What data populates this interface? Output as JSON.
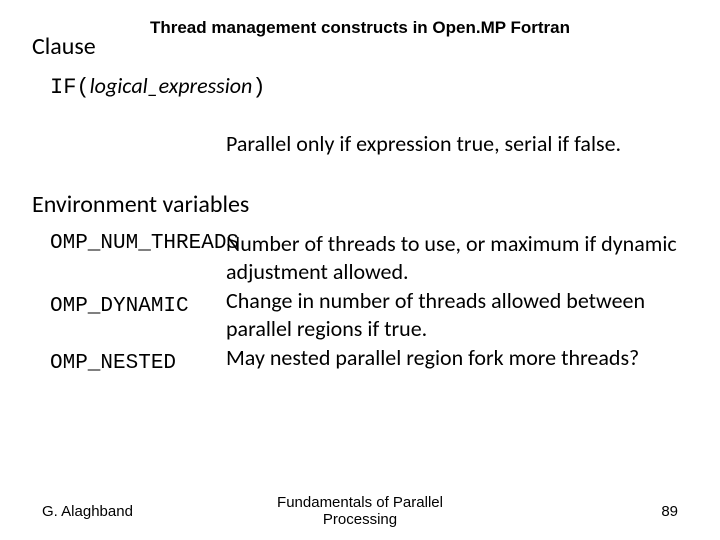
{
  "title": "Thread management constructs in Open.MP Fortran",
  "clause_label": "Clause",
  "if_keyword": "IF",
  "if_open": "(",
  "if_arg": "logical_expression",
  "if_close": ")",
  "clause_desc": "Parallel only if expression true, serial if false.",
  "env_label": "Environment variables",
  "rows": [
    {
      "name": "OMP_NUM_THREADS",
      "desc": "Number of threads to use, or maximum if dynamic adjustment allowed."
    },
    {
      "name": "OMP_DYNAMIC",
      "desc": "Change in number of threads allowed between parallel regions if true."
    },
    {
      "name": "OMP_NESTED",
      "desc": "May nested parallel region fork more threads?"
    }
  ],
  "footer": {
    "author": "G. Alaghband",
    "center": "Fundamentals of Parallel\nProcessing",
    "page": "89"
  }
}
